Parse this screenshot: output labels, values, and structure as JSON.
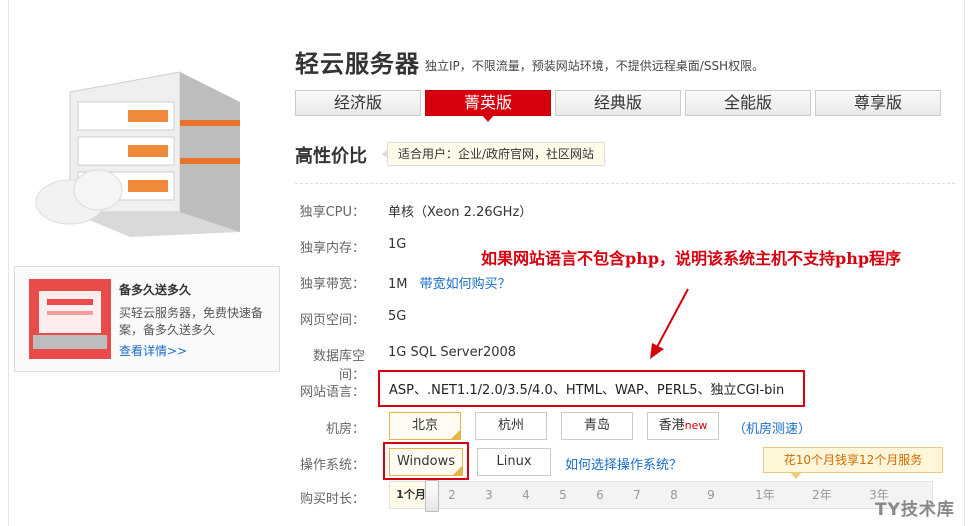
{
  "header": {
    "title": "轻云服务器",
    "subtitle": "独立IP，不限流量，预装网站环境，不提供远程桌面/SSH权限。"
  },
  "tabs": [
    "经济版",
    "菁英版",
    "经典版",
    "全能版",
    "尊享版"
  ],
  "active_tab": "菁英版",
  "section": {
    "title": "高性价比",
    "fit_badge": "适合用户：企业/政府官网，社区网站"
  },
  "specs": {
    "cpu_label": "独享CPU：",
    "cpu_value": "单核（Xeon 2.26GHz）",
    "memory_label": "独享内存：",
    "memory_value": "1G",
    "bandwidth_label": "独享带宽：",
    "bandwidth_value": "1M",
    "bandwidth_link": "带宽如何购买？",
    "web_space_label": "网页空间：",
    "web_space_value": "5G",
    "db_space_label": "数据库空间：",
    "db_space_value": "1G SQL Server2008",
    "lang_label": "网站语言：",
    "lang_value": "ASP、.NET1.1/2.0/3.5/4.0、HTML、WAP、PERL5、独立CGI-bin"
  },
  "annotation": "如果网站语言不包含php，说明该系统主机不支持php程序",
  "datacenter": {
    "label": "机房：",
    "options": [
      "北京",
      "杭州",
      "青岛",
      "香港"
    ],
    "selected": "北京",
    "new_tag": "new",
    "test_link": "（机房测速）"
  },
  "os": {
    "label": "操作系统：",
    "options": [
      "Windows",
      "Linux"
    ],
    "selected": "Windows",
    "help_link": "如何选择操作系统？"
  },
  "duration": {
    "label": "购买时长：",
    "promo_tip": "花10个月钱享12个月服务",
    "ticks": [
      "1个月",
      "2",
      "3",
      "4",
      "5",
      "6",
      "7",
      "8",
      "9",
      "1年",
      "2年",
      "3年"
    ],
    "selected": "1个月"
  },
  "promo_card": {
    "title": "备多久送多久",
    "desc": "买轻云服务器，免费快速备案，备多久送多久",
    "link": "查看详情>>"
  },
  "watermark": "TY技术库",
  "colors": {
    "accent": "#d6000f",
    "link": "#1a6ec9"
  }
}
